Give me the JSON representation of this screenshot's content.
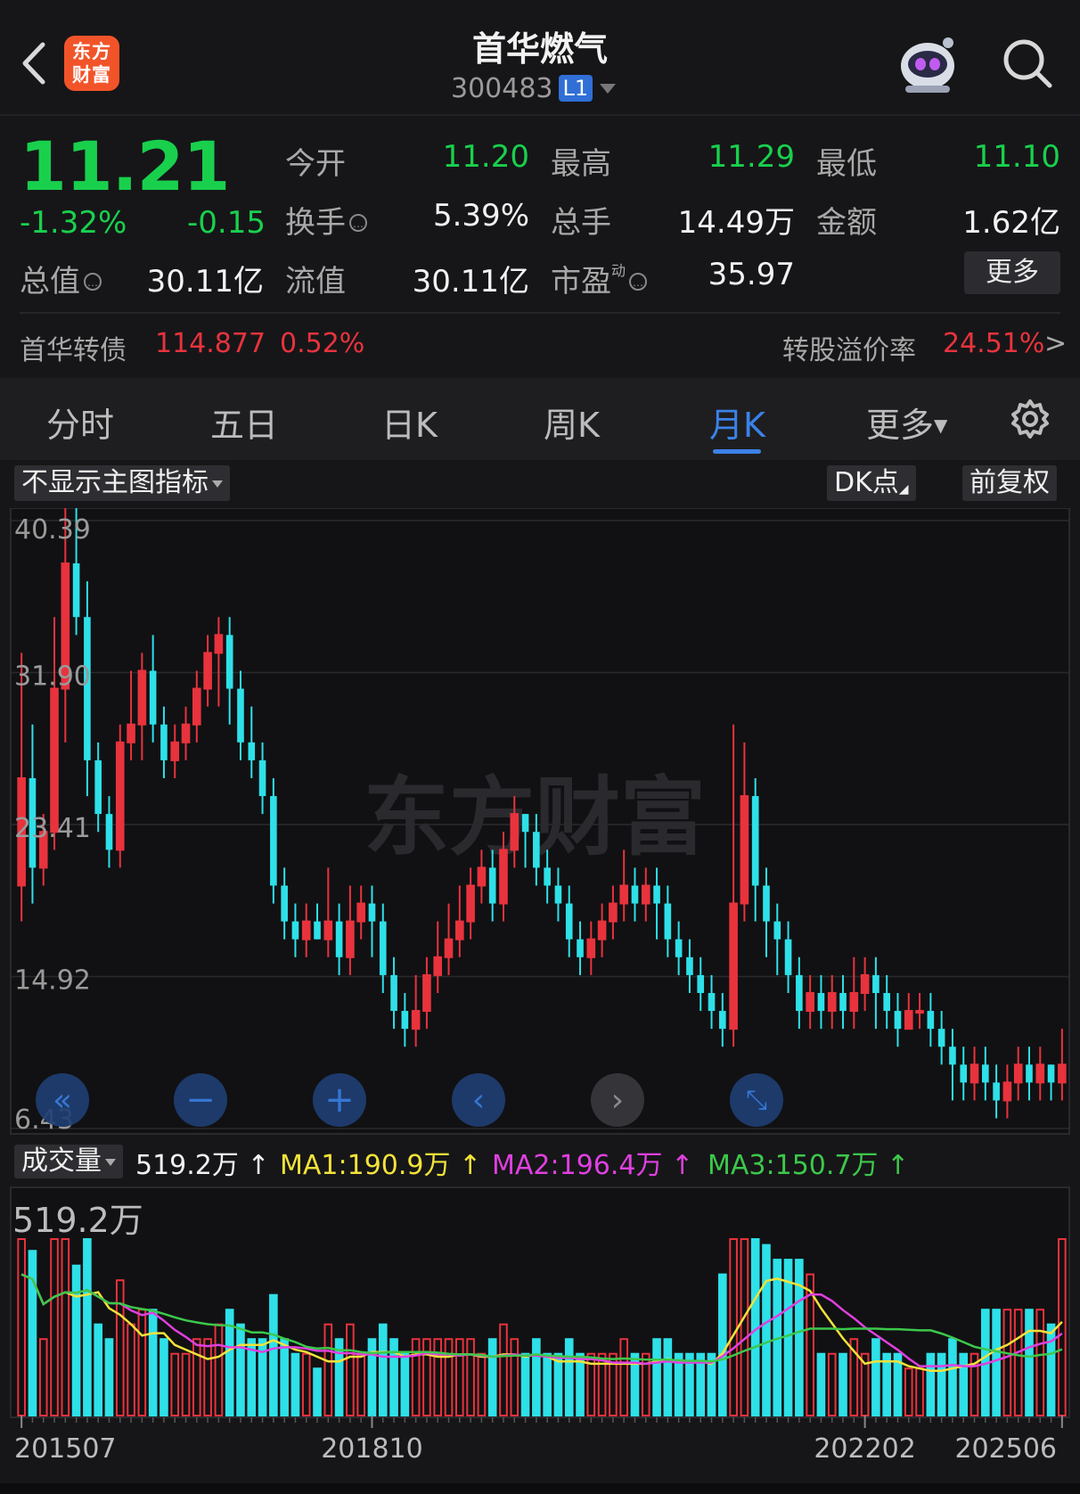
{
  "header": {
    "logo_line1": "东方",
    "logo_line2": "财富",
    "title": "首华燃气",
    "code": "300483",
    "level_badge": "L1",
    "icons": [
      "back-arrow-icon",
      "assistant-robot-icon",
      "search-icon"
    ]
  },
  "quote": {
    "price": "11.21",
    "change_pct": "-1.32%",
    "change": "-0.15",
    "open_label": "今开",
    "open": "11.20",
    "high_label": "最高",
    "high": "11.29",
    "low_label": "最低",
    "low": "11.10",
    "turnover_label": "换手",
    "turnover": "5.39%",
    "total_hands_label": "总手",
    "total_hands": "14.49万",
    "amount_label": "金额",
    "amount": "1.62亿",
    "mktcap_label": "总值",
    "mktcap": "30.11亿",
    "float_label": "流值",
    "float": "30.11亿",
    "pe_label": "市盈",
    "pe_sup": "动",
    "pe": "35.97",
    "more_label": "更多",
    "info_icon_glyph": "…"
  },
  "bond": {
    "name": "首华转债",
    "price": "114.877",
    "pct": "0.52%",
    "premium_label": "转股溢价率",
    "premium": "24.51%",
    "arrow": ">"
  },
  "tabs": [
    {
      "label": "分时"
    },
    {
      "label": "五日"
    },
    {
      "label": "日K"
    },
    {
      "label": "周K"
    },
    {
      "label": "月K",
      "active": true
    },
    {
      "label": "更多"
    }
  ],
  "toolbar": {
    "indicator": "不显示主图指标",
    "dk": "DK点",
    "adjust": "前复权"
  },
  "watermark": "东方财富",
  "volume": {
    "label": "成交量",
    "current": "519.2万 ↑",
    "ma1": "MA1:190.9万 ↑",
    "ma2": "MA2:196.4万 ↑",
    "ma3": "MA3:150.7万 ↑",
    "scale_label": "519.2万",
    "colors": {
      "ma1": "#f2e23a",
      "ma2": "#e040e0",
      "ma3": "#3cc84a"
    }
  },
  "colors": {
    "up": "#e8333d",
    "down": "#2ee0e8",
    "accent": "#3b82e8"
  },
  "chart_data": {
    "type": "candlestick",
    "y_ticks": [
      "40.39",
      "31.90",
      "23.41",
      "14.92",
      "6.43"
    ],
    "ylim": [
      6.43,
      40.39
    ],
    "x_labels": [
      "201507",
      "201810",
      "202202",
      "202506"
    ],
    "candles": [
      [
        20,
        26,
        18,
        33
      ],
      [
        26,
        21,
        19,
        29
      ],
      [
        21,
        23,
        20,
        24
      ],
      [
        23,
        31,
        22,
        35
      ],
      [
        31,
        38,
        28,
        42
      ],
      [
        38,
        35,
        34,
        43
      ],
      [
        35,
        27,
        25,
        37
      ],
      [
        27,
        24,
        23,
        28
      ],
      [
        24,
        22,
        21,
        25
      ],
      [
        22,
        28,
        21,
        29
      ],
      [
        28,
        29,
        27,
        32
      ],
      [
        29,
        32,
        27,
        33
      ],
      [
        32,
        29,
        28,
        34
      ],
      [
        29,
        27,
        26,
        30
      ],
      [
        27,
        28,
        26,
        29
      ],
      [
        28,
        29,
        27,
        30
      ],
      [
        29,
        31,
        28,
        32
      ],
      [
        31,
        33,
        30,
        34
      ],
      [
        33,
        34,
        30,
        35
      ],
      [
        34,
        31,
        29,
        35
      ],
      [
        31,
        28,
        27,
        32
      ],
      [
        28,
        27,
        26,
        30
      ],
      [
        27,
        25,
        24,
        28
      ],
      [
        25,
        20,
        19,
        26
      ],
      [
        20,
        18,
        17,
        21
      ],
      [
        18,
        17,
        16,
        19
      ],
      [
        17,
        18,
        16,
        19
      ],
      [
        18,
        17,
        17,
        19
      ],
      [
        17,
        18,
        16,
        21
      ],
      [
        18,
        16,
        15,
        19
      ],
      [
        16,
        18,
        15,
        20
      ],
      [
        18,
        19,
        17,
        20
      ],
      [
        19,
        18,
        16,
        20
      ],
      [
        18,
        15,
        14,
        19
      ],
      [
        15,
        13,
        12,
        16
      ],
      [
        13,
        12,
        11,
        14
      ],
      [
        12,
        13,
        11,
        15
      ],
      [
        13,
        15,
        12,
        16
      ],
      [
        15,
        16,
        14,
        18
      ],
      [
        16,
        17,
        15,
        19
      ],
      [
        17,
        18,
        16,
        20
      ],
      [
        18,
        20,
        17,
        21
      ],
      [
        20,
        21,
        19,
        22
      ],
      [
        21,
        19,
        18,
        22
      ],
      [
        19,
        22,
        18,
        23
      ],
      [
        22,
        24,
        21,
        25
      ],
      [
        24,
        23,
        21,
        24
      ],
      [
        23,
        21,
        20,
        24
      ],
      [
        21,
        20,
        19,
        22
      ],
      [
        20,
        19,
        18,
        21
      ],
      [
        19,
        17,
        16,
        20
      ],
      [
        17,
        16,
        15,
        18
      ],
      [
        16,
        17,
        15,
        18
      ],
      [
        17,
        18,
        16,
        19
      ],
      [
        18,
        19,
        17,
        20
      ],
      [
        19,
        20,
        18,
        22
      ],
      [
        20,
        19,
        18,
        21
      ],
      [
        19,
        20,
        18,
        21
      ],
      [
        20,
        19,
        17,
        21
      ],
      [
        19,
        17,
        16,
        20
      ],
      [
        17,
        16,
        15,
        18
      ],
      [
        16,
        15,
        14,
        17
      ],
      [
        15,
        14,
        13,
        16
      ],
      [
        14,
        13,
        12,
        15
      ],
      [
        13,
        12,
        11,
        14
      ],
      [
        12,
        19,
        11,
        29
      ],
      [
        19,
        25,
        18,
        28
      ],
      [
        25,
        20,
        18,
        26
      ],
      [
        20,
        18,
        16,
        21
      ],
      [
        18,
        17,
        15,
        19
      ],
      [
        17,
        15,
        14,
        18
      ],
      [
        15,
        13,
        12,
        16
      ],
      [
        13,
        14,
        12,
        15
      ],
      [
        14,
        13,
        12,
        15
      ],
      [
        13,
        14,
        12,
        15
      ],
      [
        14,
        13,
        12,
        15
      ],
      [
        13,
        14,
        12,
        16
      ],
      [
        14,
        15,
        13,
        16
      ],
      [
        15,
        14,
        12,
        16
      ],
      [
        14,
        13,
        12,
        15
      ],
      [
        13,
        12,
        11,
        14
      ],
      [
        12,
        13,
        12,
        14
      ],
      [
        13,
        13,
        12,
        14
      ],
      [
        13,
        12,
        11,
        14
      ],
      [
        12,
        11,
        10,
        13
      ],
      [
        11,
        10,
        8,
        12
      ],
      [
        10,
        9,
        8,
        11
      ],
      [
        9,
        10,
        8,
        11
      ],
      [
        10,
        9,
        8,
        11
      ],
      [
        9,
        8,
        7,
        10
      ],
      [
        8,
        9,
        7,
        10
      ],
      [
        9,
        10,
        8,
        11
      ],
      [
        10,
        9,
        8,
        11
      ],
      [
        9,
        10,
        8,
        11
      ],
      [
        10,
        9,
        8,
        10
      ],
      [
        9,
        10,
        8,
        12
      ]
    ],
    "volume_max_label": "519.2万"
  }
}
